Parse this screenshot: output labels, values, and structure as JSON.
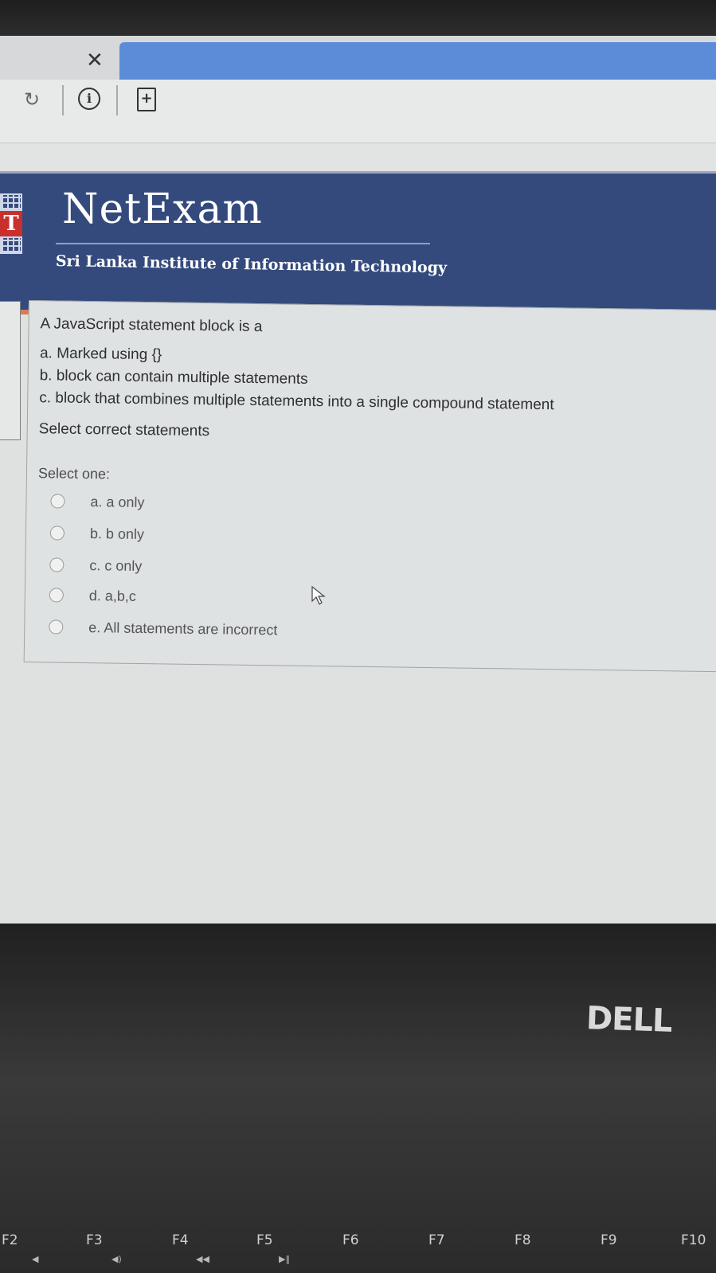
{
  "browser": {
    "close_glyph": "✕",
    "reload_glyph": "↻",
    "info_glyph": "i",
    "page_glyph": "+",
    "active_tab_color": "#5c8bd8"
  },
  "header": {
    "brand": "NetExam",
    "institute": "Sri Lanka Institute of Information Technology",
    "logo_letter": "T",
    "banner_color": "#344a7d",
    "stripe_color": "#d97b56"
  },
  "question": {
    "title": "A JavaScript statement block is a",
    "statements": [
      "a. Marked using {}",
      "b. block can contain multiple statements",
      "c. block that combines multiple statements into a single compound statement"
    ],
    "instruction": "Select correct statements",
    "select_label": "Select one:",
    "options": [
      "a. a only",
      "b. b only",
      "c. c only",
      "d. a,b,c",
      "e. All statements are incorrect"
    ]
  },
  "device": {
    "brand": "DELL",
    "function_keys": [
      "F2",
      "F3",
      "F4",
      "F5",
      "F6",
      "F7",
      "F8",
      "F9",
      "F10"
    ]
  }
}
